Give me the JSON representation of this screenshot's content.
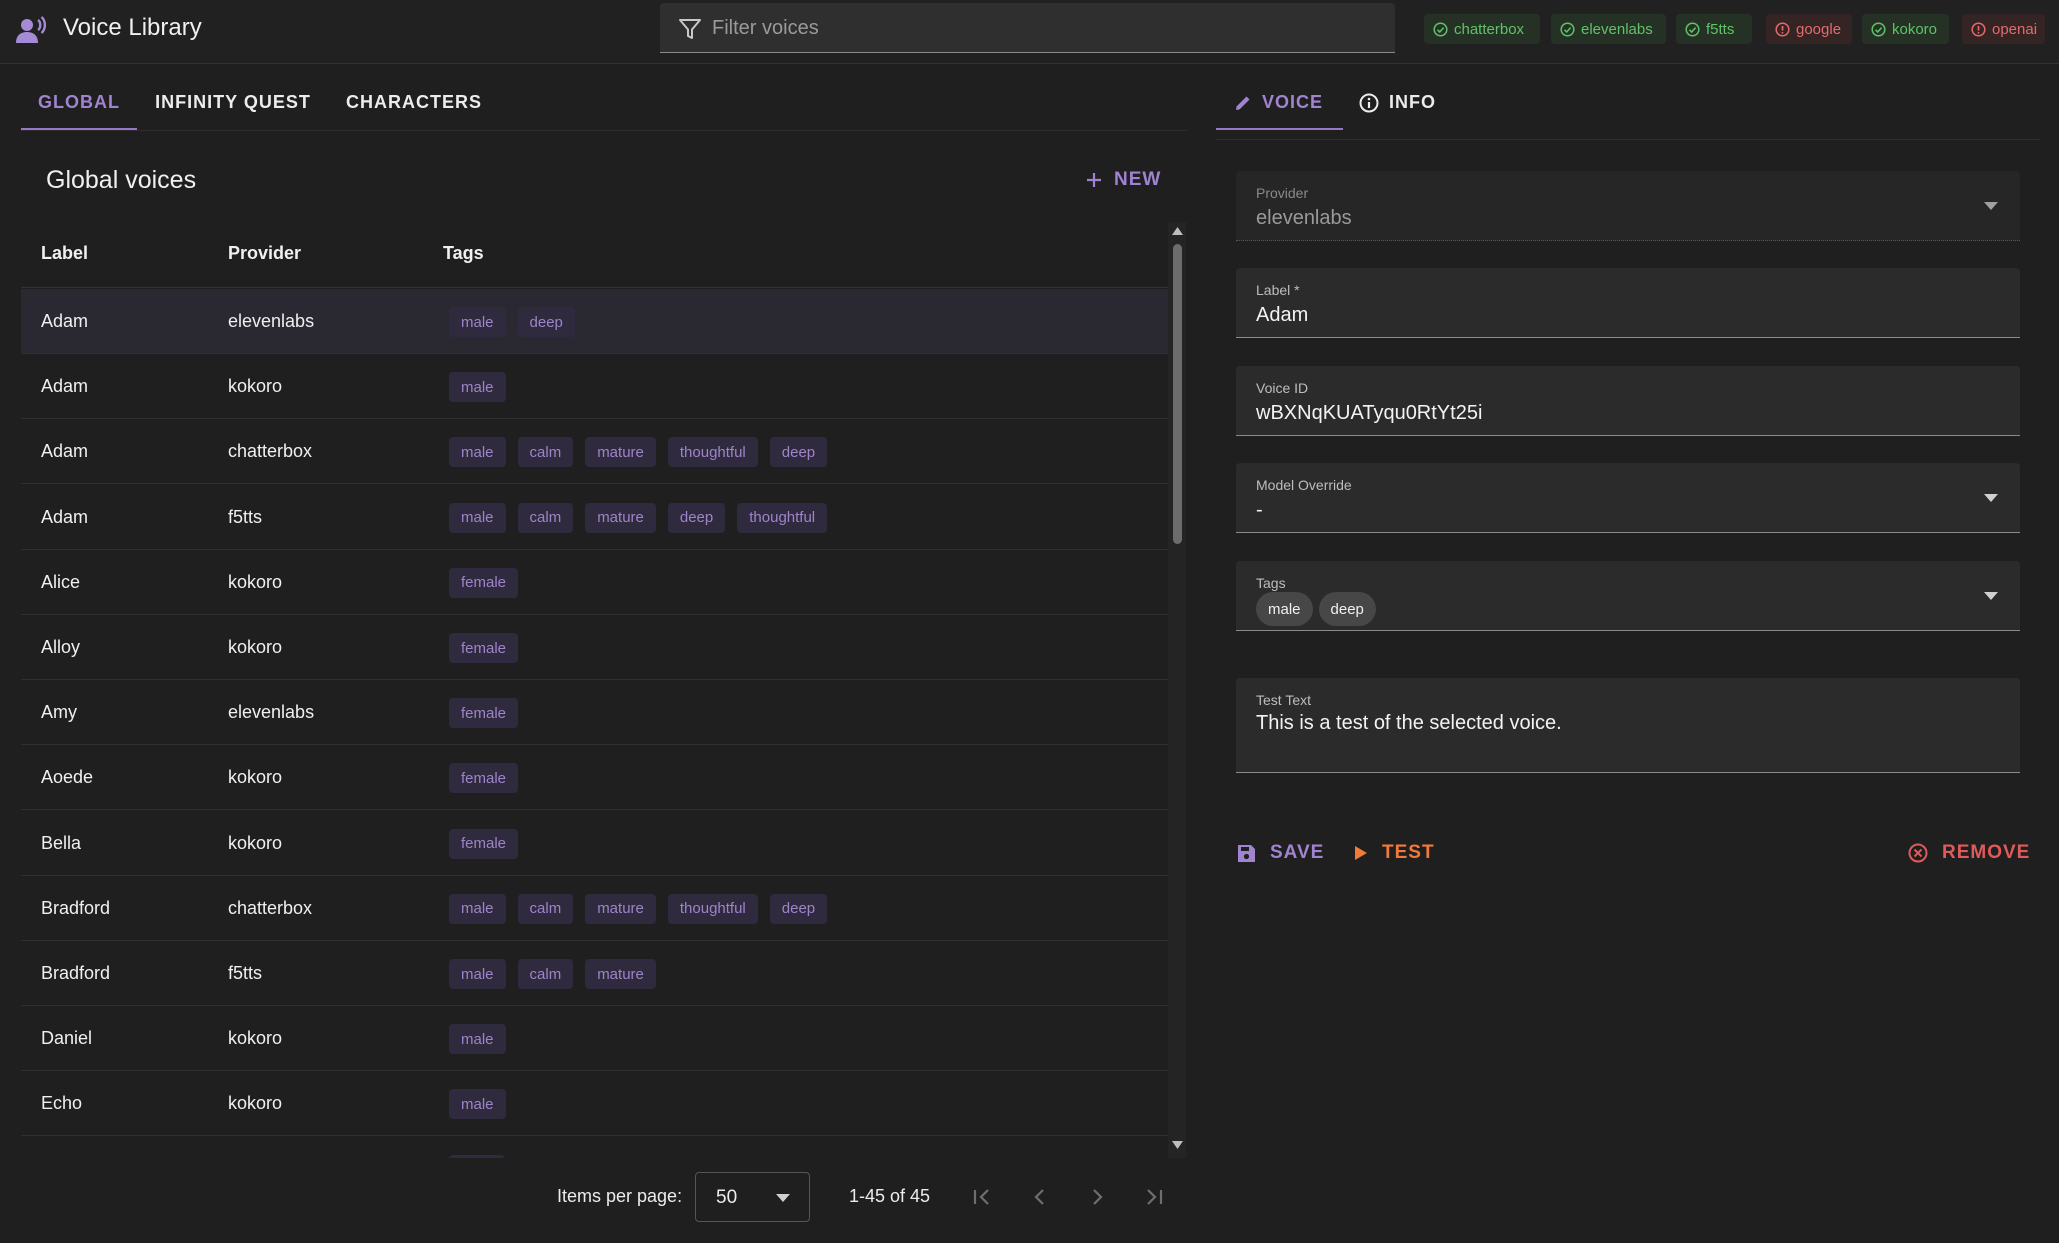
{
  "app": {
    "title": "Voice Library",
    "filter_placeholder": "Filter voices"
  },
  "providers_status": [
    {
      "name": "chatterbox",
      "status": "ok"
    },
    {
      "name": "elevenlabs",
      "status": "ok"
    },
    {
      "name": "f5tts",
      "status": "ok"
    },
    {
      "name": "google",
      "status": "error"
    },
    {
      "name": "kokoro",
      "status": "ok"
    },
    {
      "name": "openai",
      "status": "error"
    }
  ],
  "left_tabs": [
    {
      "label": "GLOBAL",
      "active": true
    },
    {
      "label": "INFINITY QUEST",
      "active": false
    },
    {
      "label": "CHARACTERS",
      "active": false
    }
  ],
  "list": {
    "heading": "Global voices",
    "new_label": "NEW",
    "columns": [
      "Label",
      "Provider",
      "Tags"
    ],
    "rows": [
      {
        "label": "Adam",
        "provider": "elevenlabs",
        "tags": [
          "male",
          "deep"
        ],
        "selected": true
      },
      {
        "label": "Adam",
        "provider": "kokoro",
        "tags": [
          "male"
        ]
      },
      {
        "label": "Adam",
        "provider": "chatterbox",
        "tags": [
          "male",
          "calm",
          "mature",
          "thoughtful",
          "deep"
        ]
      },
      {
        "label": "Adam",
        "provider": "f5tts",
        "tags": [
          "male",
          "calm",
          "mature",
          "deep",
          "thoughtful"
        ]
      },
      {
        "label": "Alice",
        "provider": "kokoro",
        "tags": [
          "female"
        ]
      },
      {
        "label": "Alloy",
        "provider": "kokoro",
        "tags": [
          "female"
        ]
      },
      {
        "label": "Amy",
        "provider": "elevenlabs",
        "tags": [
          "female"
        ]
      },
      {
        "label": "Aoede",
        "provider": "kokoro",
        "tags": [
          "female"
        ]
      },
      {
        "label": "Bella",
        "provider": "kokoro",
        "tags": [
          "female"
        ]
      },
      {
        "label": "Bradford",
        "provider": "chatterbox",
        "tags": [
          "male",
          "calm",
          "mature",
          "thoughtful",
          "deep"
        ]
      },
      {
        "label": "Bradford",
        "provider": "f5tts",
        "tags": [
          "male",
          "calm",
          "mature"
        ]
      },
      {
        "label": "Daniel",
        "provider": "kokoro",
        "tags": [
          "male"
        ]
      },
      {
        "label": "Echo",
        "provider": "kokoro",
        "tags": [
          "male"
        ]
      }
    ]
  },
  "paginator": {
    "items_per_page_label": "Items per page:",
    "items_per_page": "50",
    "range": "1-45 of 45"
  },
  "right_tabs": [
    {
      "label": "VOICE",
      "active": true,
      "icon": "pencil-icon"
    },
    {
      "label": "INFO",
      "active": false,
      "icon": "info-icon"
    }
  ],
  "form": {
    "provider_label": "Provider",
    "provider_value": "elevenlabs",
    "label_label": "Label *",
    "label_value": "Adam",
    "voice_id_label": "Voice ID",
    "voice_id_value": "wBXNqKUATyqu0RtYt25i",
    "model_override_label": "Model Override",
    "model_override_value": "-",
    "tags_label": "Tags",
    "tags": [
      "male",
      "deep"
    ],
    "test_text_label": "Test Text",
    "test_text_value": "This is a test of the selected voice."
  },
  "actions": {
    "save": "SAVE",
    "test": "TEST",
    "remove": "REMOVE"
  },
  "colors": {
    "accent": "#9f82d2",
    "ok": "#5ec267",
    "error": "#e36b6b",
    "test": "#f07a3c"
  }
}
